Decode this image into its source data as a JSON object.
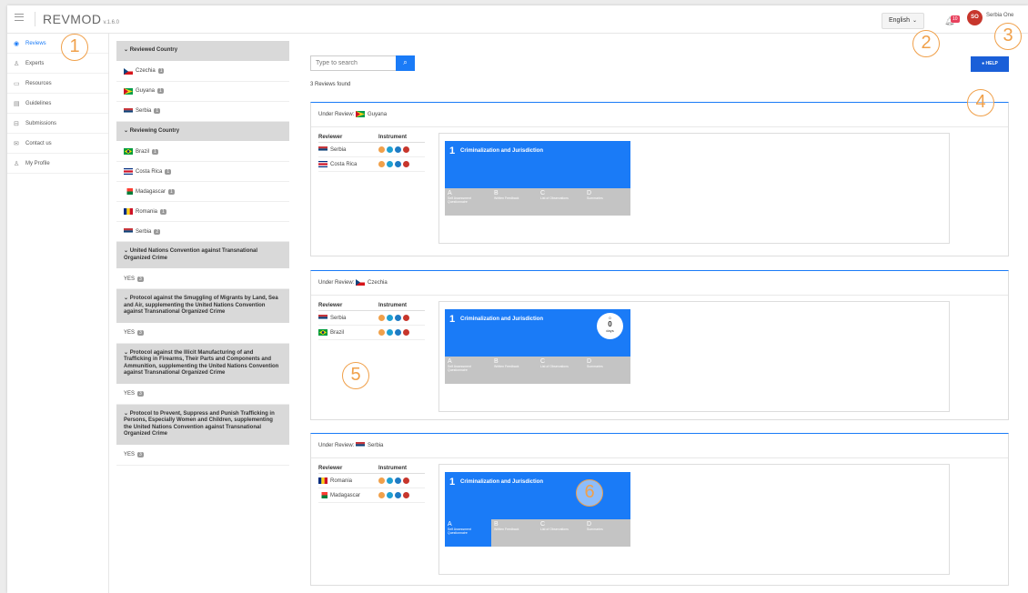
{
  "app": {
    "logo": "REVMOD",
    "version": "v.1.6.0"
  },
  "topbar": {
    "language": "English",
    "notif_count": "10",
    "avatar_initials": "SO",
    "user_name": "Serbia One"
  },
  "sidebar": {
    "items": [
      {
        "label": "Reviews",
        "icon": "eye-icon"
      },
      {
        "label": "Experts",
        "icon": "users-icon"
      },
      {
        "label": "Resources",
        "icon": "folder-icon"
      },
      {
        "label": "Guidelines",
        "icon": "book-icon"
      },
      {
        "label": "Submissions",
        "icon": "inbox-icon"
      },
      {
        "label": "Contact us",
        "icon": "mail-icon"
      },
      {
        "label": "My Profile",
        "icon": "user-icon"
      }
    ]
  },
  "filters": {
    "reviewed_header": "Reviewed Country",
    "reviewed": [
      {
        "name": "Czechia",
        "count": "1"
      },
      {
        "name": "Guyana",
        "count": "1"
      },
      {
        "name": "Serbia",
        "count": "1"
      }
    ],
    "reviewing_header": "Reviewing Country",
    "reviewing": [
      {
        "name": "Brazil",
        "count": "1"
      },
      {
        "name": "Costa Rica",
        "count": "1"
      },
      {
        "name": "Madagascar",
        "count": "1"
      },
      {
        "name": "Romania",
        "count": "1"
      },
      {
        "name": "Serbia",
        "count": "2"
      }
    ],
    "instruments": [
      {
        "title": "United Nations Convention against Transnational Organized Crime",
        "value": "YES",
        "count": "3"
      },
      {
        "title": "Protocol against the Smuggling of Migrants by Land, Sea and Air, supplementing the United Nations Convention against Transnational Organized Crime",
        "value": "YES",
        "count": "3"
      },
      {
        "title": "Protocol against the Illicit Manufacturing of and Trafficking in Firearms, Their Parts and Components and Ammunition, supplementing the United Nations Convention against Transnational Organized Crime",
        "value": "YES",
        "count": "3"
      },
      {
        "title": "Protocol to Prevent, Suppress and Punish Trafficking in Persons, Especially Women and Children, supplementing the United Nations Convention against Transnational Organized Crime",
        "value": "YES",
        "count": "3"
      }
    ]
  },
  "main": {
    "search_placeholder": "Type to search",
    "found": "3 Reviews found",
    "help": "HELP",
    "under_review_label": "Under Review:",
    "col_reviewer": "Reviewer",
    "col_instrument": "Instrument",
    "tile_num": "1",
    "tile_label": "Criminalization and Jurisdiction",
    "steps": [
      {
        "letter": "A",
        "desc": "Self Assessment Questionnaire"
      },
      {
        "letter": "B",
        "desc": "Written Feedback"
      },
      {
        "letter": "C",
        "desc": "List of Observations"
      },
      {
        "letter": "D",
        "desc": "Summaries"
      }
    ],
    "timer": {
      "top": "0",
      "value": "0",
      "unit": "days"
    },
    "reviews": [
      {
        "country": "Guyana",
        "reviewers": [
          "Serbia",
          "Costa Rica"
        ]
      },
      {
        "country": "Czechia",
        "reviewers": [
          "Serbia",
          "Brazil"
        ]
      },
      {
        "country": "Serbia",
        "reviewers": [
          "Romania",
          "Madagascar"
        ]
      }
    ]
  },
  "callouts": [
    "1",
    "2",
    "3",
    "4",
    "5",
    "6"
  ],
  "colors": {
    "accent": "#1a7bf7",
    "callout": "#f0a04a",
    "step_inactive": "#c4c4c4"
  }
}
